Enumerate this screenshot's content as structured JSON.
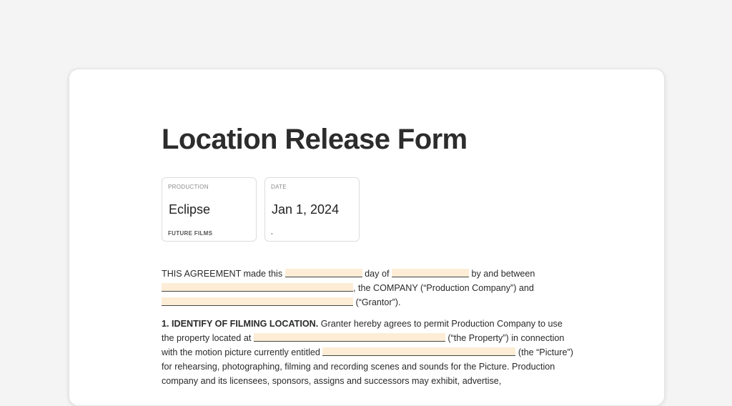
{
  "title": "Location Release Form",
  "cards": {
    "production": {
      "label": "PRODUCTION",
      "value": "Eclipse",
      "sub": "FUTURE FILMS"
    },
    "date": {
      "label": "DATE",
      "value": "Jan 1, 2024",
      "sub": "-"
    }
  },
  "agreement": {
    "t1": "THIS AGREEMENT made this",
    "t2": "day of",
    "t3": "by and between",
    "t4": ", the COMPANY (“Production Company”) and",
    "t5": "(“Grantor”)."
  },
  "section1": {
    "heading": "1. IDENTIFY OF FILMING LOCATION.",
    "t1": "Granter hereby agrees to permit Production Company to use the property located at",
    "t2": "(“the Property”) in connection with the motion picture currently entitled",
    "t3": "(the “Picture”) for rehearsing, photographing, filming and recording scenes and sounds for the Picture. Production company and its licensees, sponsors, assigns and successors may exhibit, advertise,"
  },
  "colors": {
    "blank_fill": "#fdedd6",
    "background": "#f4f4f4"
  }
}
